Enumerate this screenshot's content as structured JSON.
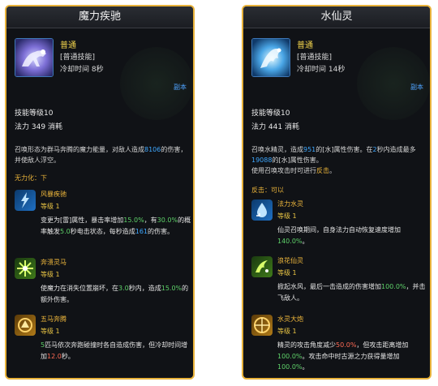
{
  "left": {
    "title": "魔力疾驰",
    "quality": "普通",
    "tag": "[普通技能]",
    "cd_label": "冷却时间",
    "cd": "8秒",
    "dungeon_tag": "副本",
    "level_label": "技能等级",
    "level": "10",
    "mana_label": "法力",
    "mana": "349",
    "mana_suffix": "消耗",
    "desc_1": "召唤形态为群马奔腾的魔力能量，对敌人造成",
    "desc_num": "8106",
    "desc_2": "的伤害，并使敌人浮空。",
    "condition": "无力化：下",
    "subs": [
      {
        "name": "风暴疾驰",
        "level": "等级 1",
        "d1": "变更为[雷]属性，暴击率增加",
        "n1": "15.0%",
        "d2": "，有",
        "n2": "30.0%",
        "d3": "的概率触发",
        "n3": "5.0",
        "d4": "秒电击状态，每秒造成",
        "n4": "161",
        "d5": "的伤害。"
      },
      {
        "name": "奔溃灵马",
        "level": "等级 1",
        "d1": "使魔力在消失位置崩坏，在",
        "n1": "3.0",
        "d2": "秒内，造成",
        "n2": "15.0%",
        "d3": "的额外伤害。"
      },
      {
        "name": "五马奔腾",
        "level": "等级 1",
        "n1": "5",
        "d1": "匹马依次奔跑碰撞时各自造成伤害，但冷却时间增加",
        "n2": "12.0",
        "d2": "秒。"
      }
    ]
  },
  "right": {
    "title": "水仙灵",
    "quality": "普通",
    "tag": "[普通技能]",
    "cd_label": "冷却时间",
    "cd": "14秒",
    "dungeon_tag": "副本",
    "level_label": "技能等级",
    "level": "10",
    "mana_label": "法力",
    "mana": "441",
    "mana_suffix": "消耗",
    "desc_1": "召唤水精灵，造成",
    "desc_num1": "951",
    "desc_2": "的[水]属性伤害。在",
    "desc_num2": "2",
    "desc_3": "秒内造成最多",
    "desc_num3": "19088",
    "desc_4": "的[水]属性伤害。",
    "desc_5": "使用召唤攻击时可进行",
    "desc_hl": "反击",
    "desc_6": "。",
    "condition": "反击：可以",
    "subs": [
      {
        "name": "法力水灵",
        "level": "等级 1",
        "d1": "仙灵召唤期间，自身法力自动恢复速度增加",
        "n1": "140.0%",
        "d2": "。"
      },
      {
        "name": "浪花仙灵",
        "level": "等级 1",
        "d1": "掀起水风，最后一击造成的伤害增加",
        "n1": "100.0%",
        "d2": "，并击飞敌人。"
      },
      {
        "name": "水灵大炮",
        "level": "等级 1",
        "d1": "精灵的攻击角度减少",
        "n1": "50.0%",
        "d2": "，但攻击距离增加",
        "n2": "100.0%",
        "d3": "。攻击命中时古源之力获得量增加",
        "n3": "100.0%",
        "d4": "。"
      }
    ]
  },
  "colors": {
    "frame": "#e8b23a",
    "panel_bg": "#101216",
    "highlight_blue": "#3fa8ff",
    "highlight_red": "#ff6a55",
    "highlight_green": "#5fd36a",
    "gold_text": "#f0b83c"
  },
  "icons": {
    "left_main": "spectral-horse-icon",
    "left_sub_1": "storm-lightning-icon",
    "left_sub_2": "burst-spark-icon",
    "left_sub_3": "horse-charge-icon",
    "right_main": "water-spirit-icon",
    "right_sub_1": "mana-water-icon",
    "right_sub_2": "wave-spirit-icon",
    "right_sub_3": "water-cannon-icon"
  }
}
